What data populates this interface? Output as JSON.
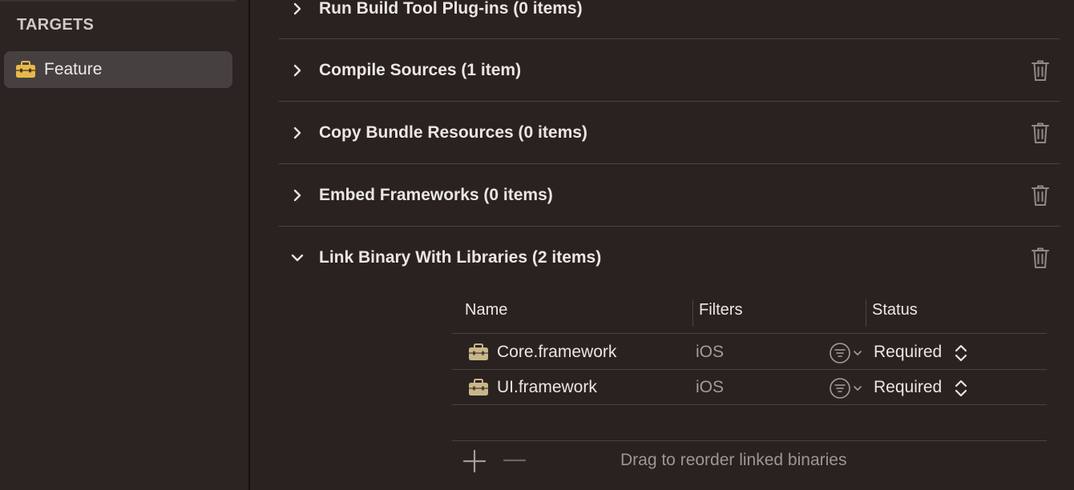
{
  "sidebar": {
    "header": "TARGETS",
    "items": [
      {
        "label": "Feature",
        "icon": "toolbox-icon",
        "selected": true
      }
    ]
  },
  "phases": [
    {
      "title": "Run Build Tool Plug-ins (0 items)",
      "expanded": false
    },
    {
      "title": "Compile Sources (1 item)",
      "expanded": false
    },
    {
      "title": "Copy Bundle Resources (0 items)",
      "expanded": false
    },
    {
      "title": "Embed Frameworks (0 items)",
      "expanded": false
    },
    {
      "title": "Link Binary With Libraries (2 items)",
      "expanded": true
    }
  ],
  "table": {
    "columns": [
      "Name",
      "Filters",
      "Status"
    ],
    "rows": [
      {
        "name": "Core.framework",
        "filter": "iOS",
        "status": "Required"
      },
      {
        "name": "UI.framework",
        "filter": "iOS",
        "status": "Required"
      }
    ]
  },
  "footer": {
    "hint": "Drag to reorder linked binaries"
  },
  "colors": {
    "background": "#292220",
    "sidebar_selected": "#464140",
    "toolbox_yellow": "#e8b849",
    "framework_tan": "#c9b68a"
  }
}
